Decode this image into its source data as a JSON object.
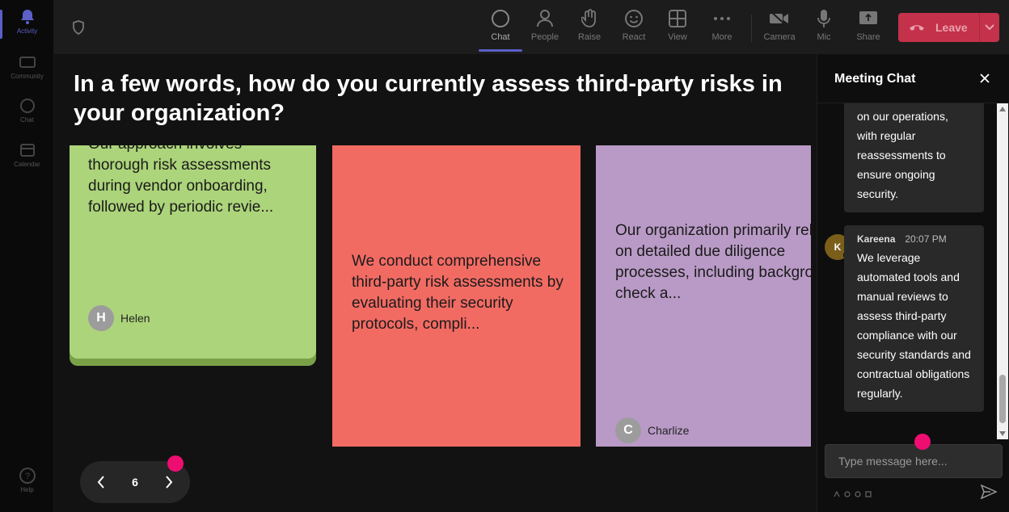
{
  "rail": [
    {
      "label": "Activity",
      "icon": "bell-icon"
    },
    {
      "label": "Community",
      "icon": "community-icon"
    },
    {
      "label": "Chat",
      "icon": "chat-icon"
    },
    {
      "label": "Calendar",
      "icon": "calendar-icon"
    },
    {
      "label": "Help",
      "icon": "help-icon"
    }
  ],
  "toolbar": {
    "chat": "Chat",
    "people": "People",
    "raise": "Raise",
    "react": "React",
    "view": "View",
    "more": "More",
    "camera": "Camera",
    "mic": "Mic",
    "share": "Share",
    "leave": "Leave"
  },
  "question": "In a few words, how do you currently assess third-party risks in your organization?",
  "cards": [
    {
      "text": "Our approach involves thorough risk assessments during vendor onboarding, followed by periodic revie...",
      "author": "Helen",
      "initial": "H",
      "color": "#acd47a"
    },
    {
      "text": "We conduct comprehensive third-party risk assessments by evaluating their security protocols, compli...",
      "color": "#f26b63"
    },
    {
      "text": "Our organization primarily relies on detailed due diligence processes, including background check a...",
      "author": "Charlize",
      "initial": "C",
      "color": "#b99ac6"
    }
  ],
  "pager": {
    "page": "6"
  },
  "chat": {
    "title": "Meeting Chat",
    "messages": [
      {
        "text": "on our operations, with regular reassessments to ensure ongoing security."
      },
      {
        "author": "Kareena",
        "initial": "K",
        "time": "20:07 PM",
        "text": "We leverage automated tools and manual reviews to assess third-party compliance with our security standards and contractual obligations regularly."
      }
    ],
    "input_placeholder": "Type message here..."
  },
  "colors": {
    "accent": "#5b5fc7",
    "leave": "#c4314b",
    "marker": "#ee0e72"
  }
}
